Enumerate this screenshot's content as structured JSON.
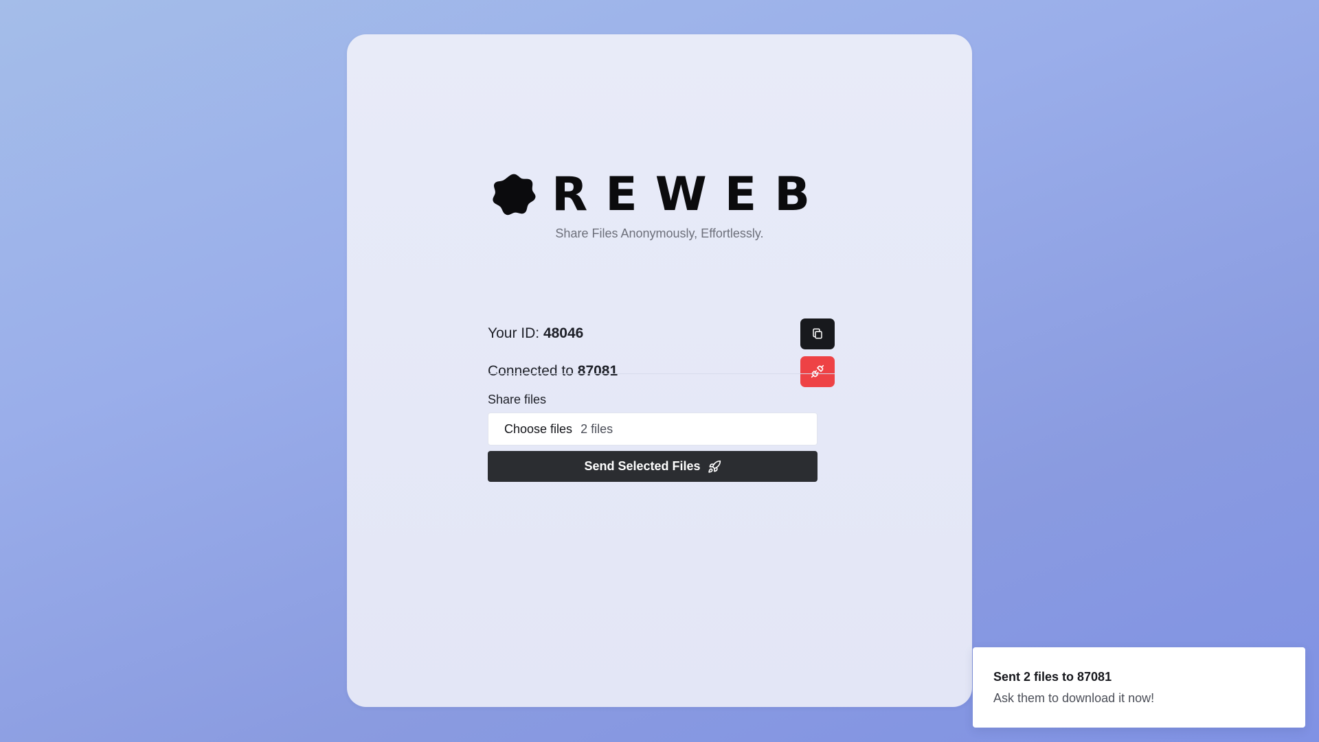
{
  "brand": {
    "name": "REWEB",
    "tagline": "Share Files Anonymously, Effortlessly."
  },
  "identity": {
    "id_label": "Your ID: ",
    "id_value": "48046",
    "copy_icon": "copy-icon"
  },
  "connection": {
    "label": "Connected to ",
    "peer_id": "87081",
    "disconnect_icon": "unplug-icon"
  },
  "share": {
    "label": "Share files",
    "choose_button": "Choose files",
    "file_status": "2 files",
    "send_button": "Send Selected Files",
    "send_icon": "rocket-icon"
  },
  "toast": {
    "title": "Sent 2 files to 87081",
    "message": "Ask them to download it now!"
  },
  "colors": {
    "accent_dark": "#18191d",
    "danger": "#ee4245",
    "card_background": "#e6e9f7"
  }
}
